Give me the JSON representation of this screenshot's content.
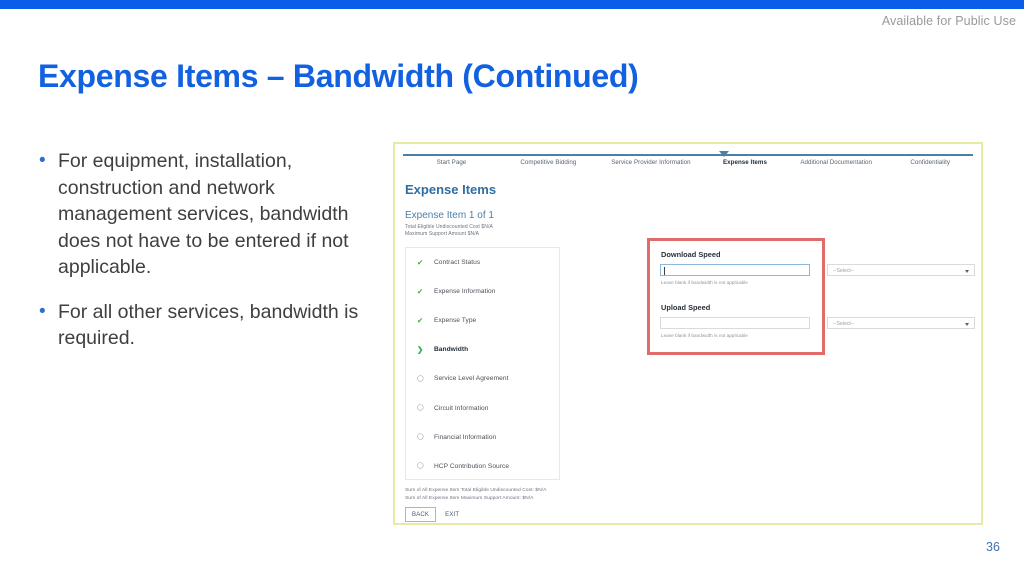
{
  "header": {
    "notice": "Available for Public Use"
  },
  "slide": {
    "title": "Expense Items – Bandwidth (Continued)",
    "page_number": "36",
    "accent_color": "#1161e0",
    "top_bar_color": "#0b5ce8"
  },
  "bullets": [
    "For equipment, installation, construction and network management services, bandwidth does not have to be entered if not applicable.",
    "For all other services, bandwidth is required."
  ],
  "screenshot": {
    "border_color": "#e7e9a6",
    "wizard": {
      "active_tab": "Expense Items",
      "tabs": [
        "Start Page",
        "Competitive Bidding",
        "Service Provider Information",
        "Expense Items",
        "Additional Documentation",
        "Confidentiality"
      ]
    },
    "page_heading": "Expense Items",
    "item_heading": "Expense Item 1 of 1",
    "item_details": [
      "Total Eligible Undiscounted Cost $N/A",
      "Maximum Support Amount $N/A"
    ],
    "checklist": [
      {
        "label": "Contract Status",
        "state": "complete",
        "icon": "check-icon"
      },
      {
        "label": "Expense Information",
        "state": "complete",
        "icon": "check-icon"
      },
      {
        "label": "Expense Type",
        "state": "complete",
        "icon": "check-icon"
      },
      {
        "label": "Bandwidth",
        "state": "current",
        "icon": "arrow-right-icon"
      },
      {
        "label": "Service Level Agreement",
        "state": "pending",
        "icon": "circle-icon"
      },
      {
        "label": "Circuit Information",
        "state": "pending",
        "icon": "circle-icon"
      },
      {
        "label": "Financial Information",
        "state": "pending",
        "icon": "circle-icon"
      },
      {
        "label": "HCP Contribution Source",
        "state": "pending",
        "icon": "circle-icon"
      }
    ],
    "form": {
      "highlight_color": "#e06b68",
      "download": {
        "label": "Download Speed",
        "value": "",
        "helper": "Leave blank if bandwidth is not applicable",
        "unit_select": "--Select--"
      },
      "upload": {
        "label": "Upload Speed",
        "value": "",
        "helper": "Leave blank if bandwidth is not applicable",
        "unit_select": "--Select--"
      }
    },
    "summary": [
      "Sum of All Expense Item Total Eligible Undiscounted Cost: $N/A",
      "Sum of All Expense Item Maximum Support Amount: $N/A"
    ],
    "buttons": {
      "back": "BACK",
      "exit": "EXIT"
    }
  }
}
